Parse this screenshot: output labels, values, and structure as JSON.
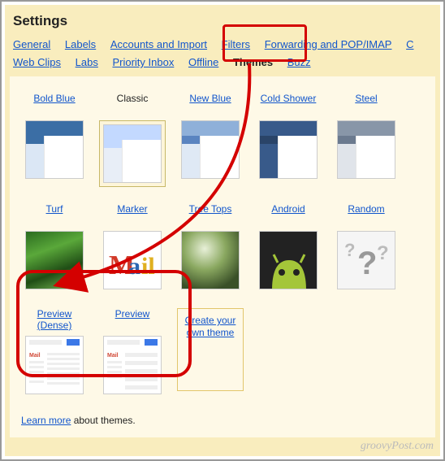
{
  "header": {
    "title": "Settings"
  },
  "tabs": {
    "general": "General",
    "labels": "Labels",
    "accounts": "Accounts and Import",
    "filters": "Filters",
    "forwarding": "Forwarding and POP/IMAP",
    "c_partial": "C",
    "webclips": "Web Clips",
    "labs": "Labs",
    "priority": "Priority Inbox",
    "offline": "Offline",
    "themes": "Themes",
    "buzz": "Buzz"
  },
  "themes": {
    "boldblue": "Bold Blue",
    "classic": "Classic",
    "newblue": "New Blue",
    "coldshower": "Cold Shower",
    "steel": "Steel",
    "turf": "Turf",
    "marker": "Marker",
    "treetops": "Tree Tops",
    "android": "Android",
    "random": "Random",
    "previewdense": "Preview (Dense)",
    "preview": "Preview"
  },
  "create": "Create your own theme",
  "footer": {
    "learn": "Learn more",
    "rest": " about themes."
  },
  "watermark": "groovyPost.com"
}
